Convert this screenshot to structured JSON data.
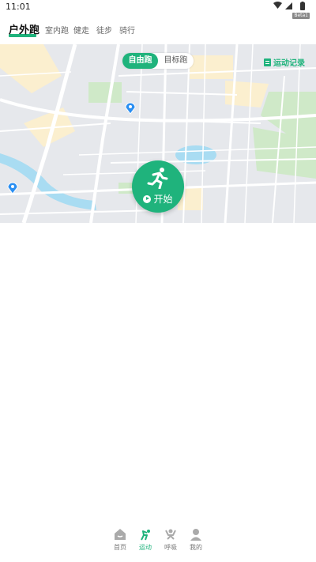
{
  "status": {
    "time": "11:01",
    "battery_label": "Beta1"
  },
  "tabs": [
    {
      "label": "户外跑",
      "active": true
    },
    {
      "label": "室内跑",
      "active": false
    },
    {
      "label": "健走",
      "active": false
    },
    {
      "label": "徒步",
      "active": false
    },
    {
      "label": "骑行",
      "active": false
    }
  ],
  "map": {
    "mode_selected": "自由跑",
    "mode_other": "目标跑",
    "record_link": "运动记录",
    "start_label": "开始"
  },
  "nav": [
    {
      "label": "首页",
      "icon": "home-icon",
      "active": false
    },
    {
      "label": "运动",
      "icon": "sport-icon",
      "active": true
    },
    {
      "label": "呼吸",
      "icon": "breath-icon",
      "active": false
    },
    {
      "label": "我的",
      "icon": "profile-icon",
      "active": false
    }
  ],
  "colors": {
    "accent": "#1fb37c",
    "map_bg": "#eceef1",
    "park": "#cfe9c8",
    "water": "#a9dcf2",
    "block": "#fbefcf"
  }
}
